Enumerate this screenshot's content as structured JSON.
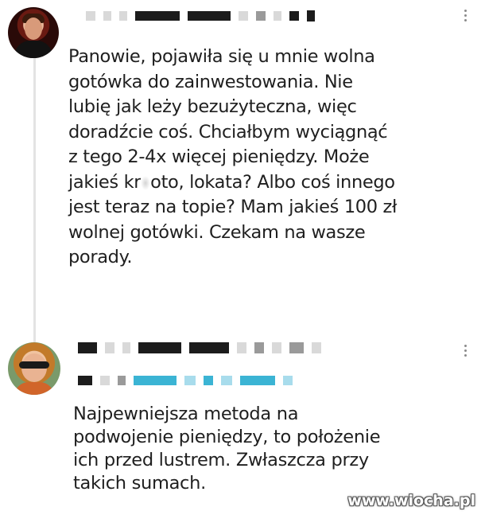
{
  "comment_1": {
    "lines": [
      "Panowie, pojawiła się u mnie wolna",
      "gotówka do zainwestowania. Nie",
      "lubię jak leży bezużyteczna, więc",
      "doradźcie coś. Chciałbym wyciągnąć",
      "z tego 2-4x więcej pieniędzy. Może",
      "jakieś kr",
      "oto, lokata? Albo coś innego",
      "jest teraz na topie? Mam jakieś 100 zł",
      "wolnej gotówki. Czekam na wasze",
      "porady."
    ]
  },
  "comment_2": {
    "lines": [
      "Najpewniejsza metoda na",
      "podwojenie pieniędzy, to położenie",
      "ich przed lustrem. Zwłaszcza przy",
      "takich sumach."
    ]
  },
  "watermark": "www.wiocha.pl",
  "icons": {
    "more_menu": "more-vertical-icon",
    "avatar": "avatar"
  },
  "colors": {
    "text": "#1f1f1f",
    "thread_line": "#e3e3e3",
    "redacted_dark": "#1c1c1c",
    "redacted_cyan": "#3bb4d4"
  }
}
